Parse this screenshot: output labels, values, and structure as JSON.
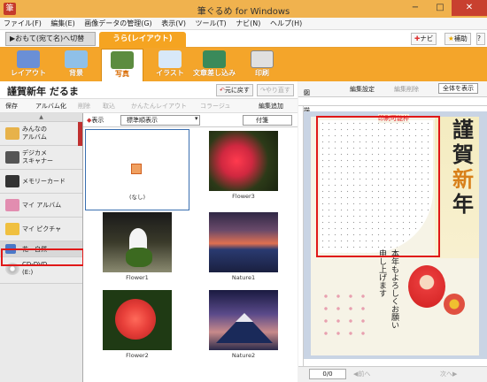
{
  "window": {
    "title": "筆ぐるめ for Windows",
    "min": "−",
    "max": "□",
    "close": "✕"
  },
  "menu": [
    "ファイル(F)",
    "編集(E)",
    "画像データの管理(G)",
    "表示(V)",
    "ツール(T)",
    "ナビ(N)",
    "ヘルプ(H)"
  ],
  "mode": {
    "omote_tab": "▶おもて(宛て名)へ切替",
    "ura_tab": "うら(レイアウト)",
    "navi": "ナビ",
    "hojo": "補助"
  },
  "tools": [
    "レイアウト",
    "背景",
    "写真",
    "イラスト",
    "文章差し込み",
    "印刷"
  ],
  "brand_char": "筆",
  "card": {
    "title": "謹賀新年 だるま",
    "undo": "元に戻す",
    "redo": "やり直す",
    "subtools": [
      "保存",
      "アルバム化",
      "削除",
      "取込",
      "かんたんレイアウト",
      "コラージュ",
      "編集追加"
    ]
  },
  "sidebar": {
    "scroll_label": "▲",
    "items": [
      {
        "label": "みんなの\nアルバム",
        "color": "#e7b24a"
      },
      {
        "label": "デジカメ\nスキャナー",
        "color": "#555555"
      },
      {
        "label": "メモリーカード",
        "color": "#333333"
      },
      {
        "label": "マイ アルバム",
        "color": "#e28db0"
      },
      {
        "label": "マイ ピクチャ",
        "color": "#f0c040"
      },
      {
        "label": "花・自然",
        "color": "#4a78c8"
      },
      {
        "label": "CD-DVD\n(E:)",
        "color": "#cccccc"
      }
    ]
  },
  "grid": {
    "view_label": "表示",
    "sort_value": "標準順表示",
    "tag_value": "付箋",
    "items": [
      {
        "caption": "(なし)"
      },
      {
        "caption": "Flower3"
      },
      {
        "caption": "Flower1"
      },
      {
        "caption": "Nature1"
      },
      {
        "caption": "Flower2"
      },
      {
        "caption": "Nature2"
      }
    ]
  },
  "preview": {
    "toolbar": {
      "zukei": "図形描画",
      "henshu": "編集設定",
      "henshu2": "編集削除",
      "zoom": "全体を表示"
    },
    "print_area_label": "印刷可能枠",
    "kanji": [
      "謹",
      "賀",
      "新",
      "年"
    ],
    "message": [
      "本年もよろしくお願い",
      "申し上げます"
    ],
    "page": "0/0",
    "prev": "前へ",
    "next": "次へ"
  },
  "colors": {
    "accent": "#f5a421",
    "highlight": "#e01818"
  }
}
